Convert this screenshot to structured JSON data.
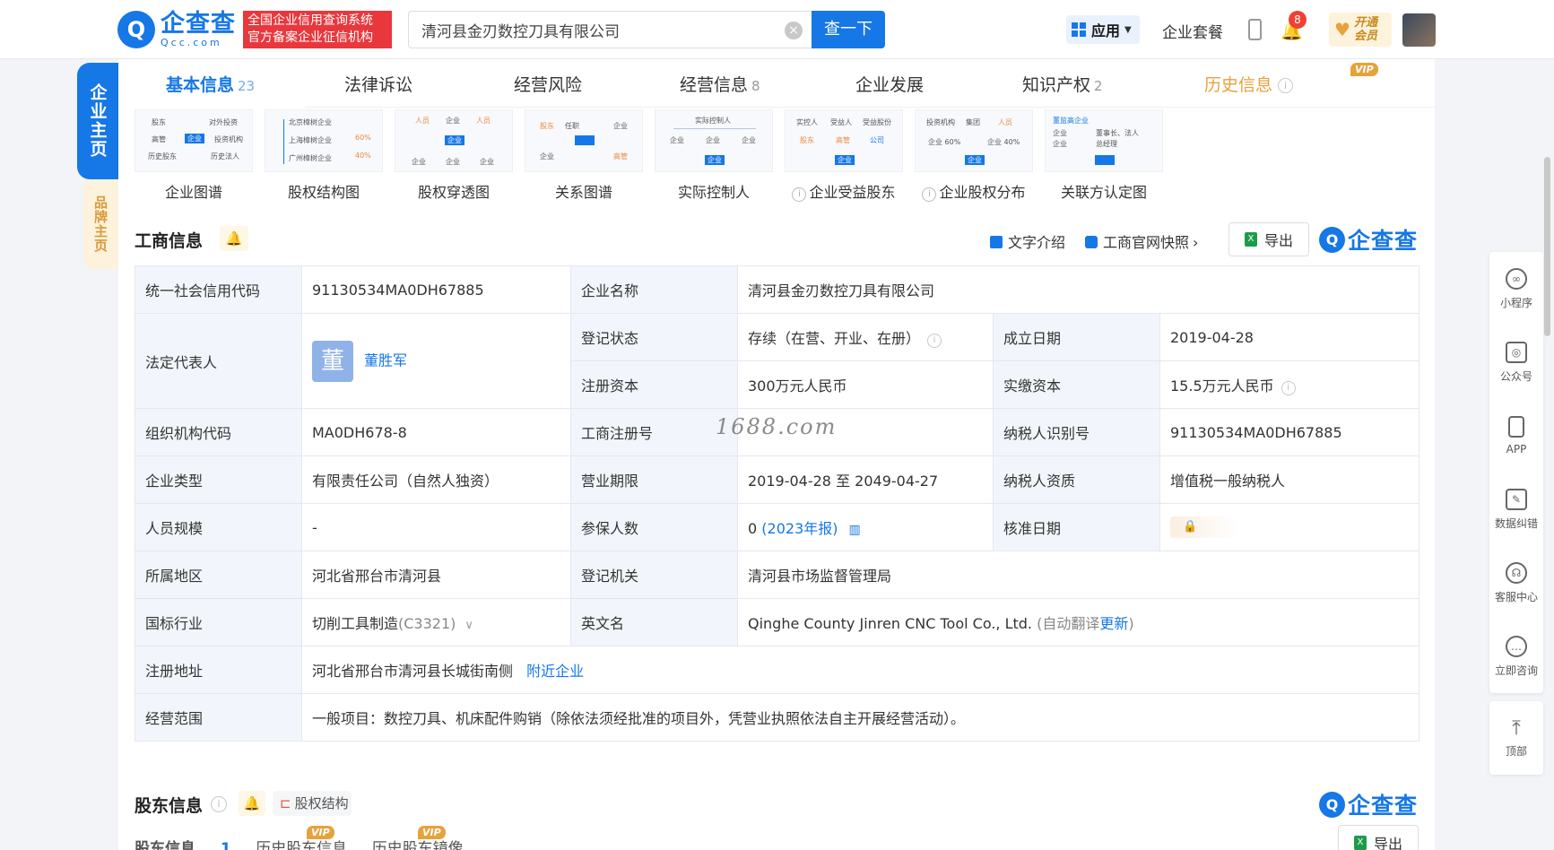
{
  "header": {
    "logo_cn": "企查查",
    "logo_en": "Qcc.com",
    "slogan_line1": "全国企业信用查询系统",
    "slogan_line2": "官方备案企业征信机构",
    "search_value": "清河县金刃数控刀具有限公司",
    "search_button": "查一下",
    "app_label": "应用",
    "package_label": "企业套餐",
    "notification_count": "8",
    "vip_line1": "开通",
    "vip_line2": "会员"
  },
  "side": {
    "main_tab": "企业主页",
    "brand_tab": "品牌主页"
  },
  "tabs": [
    {
      "label": "基本信息",
      "count": "23"
    },
    {
      "label": "法律诉讼",
      "count": ""
    },
    {
      "label": "经营风险",
      "count": ""
    },
    {
      "label": "经营信息",
      "count": "8"
    },
    {
      "label": "企业发展",
      "count": ""
    },
    {
      "label": "知识产权",
      "count": "2"
    },
    {
      "label": "历史信息",
      "count": ""
    }
  ],
  "vip_label": "VIP",
  "graphs": [
    {
      "label": "企业图谱"
    },
    {
      "label": "股权结构图"
    },
    {
      "label": "股权穿透图"
    },
    {
      "label": "关系图谱"
    },
    {
      "label": "实际控制人"
    },
    {
      "label": "企业受益股东"
    },
    {
      "label": "企业股权分布"
    },
    {
      "label": "关联方认定图"
    }
  ],
  "graph_thumbs": {
    "g1": [
      "股东",
      "对外投资",
      "高管",
      "投资机构",
      "历史股东",
      "历史法人",
      "企业"
    ],
    "g2": [
      "北京樟树企业",
      "上海樟树企业",
      "广州樟树企业",
      "60%",
      "40%"
    ],
    "g3": [
      "人员",
      "企业",
      "人员",
      "企业",
      "企业",
      "企业",
      "企业"
    ],
    "g4": [
      "股东",
      "任职",
      "企业",
      "企业",
      "高管"
    ],
    "g5": [
      "实际控制人",
      "企业",
      "企业",
      "企业",
      "企业"
    ],
    "g6": [
      "实控人",
      "受益人",
      "受益股份",
      "股东",
      "高管",
      "公司",
      "企业"
    ],
    "g7": [
      "投资机构",
      "集团",
      "人员",
      "企业 60%",
      "企业 40%",
      "企业"
    ],
    "g8": [
      "董监高企业",
      "董事长、法人",
      "总经理",
      "企业",
      "企业"
    ]
  },
  "section": {
    "title": "工商信息",
    "text_intro": "文字介绍",
    "snapshot": "工商官网快照",
    "export": "导出",
    "brand": "企查查"
  },
  "info": {
    "credit_code_k": "统一社会信用代码",
    "credit_code_v": "91130534MA0DH67885",
    "name_k": "企业名称",
    "name_v": "清河县金刃数控刀具有限公司",
    "legal_k": "法定代表人",
    "legal_avatar": "董",
    "legal_v": "董胜军",
    "status_k": "登记状态",
    "status_v": "存续（在营、开业、在册）",
    "found_k": "成立日期",
    "found_v": "2019-04-28",
    "reg_cap_k": "注册资本",
    "reg_cap_v": "300万元人民币",
    "paid_cap_k": "实缴资本",
    "paid_cap_v": "15.5万元人民币",
    "org_code_k": "组织机构代码",
    "org_code_v": "MA0DH678-8",
    "reg_no_k": "工商注册号",
    "reg_no_v": "",
    "tax_id_k": "纳税人识别号",
    "tax_id_v": "91130534MA0DH67885",
    "type_k": "企业类型",
    "type_v": "有限责任公司（自然人独资）",
    "term_k": "营业期限",
    "term_v": "2019-04-28 至 2049-04-27",
    "tax_qual_k": "纳税人资质",
    "tax_qual_v": "增值税一般纳税人",
    "staff_k": "人员规模",
    "staff_v": "-",
    "insured_k": "参保人数",
    "insured_v": "0",
    "insured_year": "(2023年报)",
    "approve_k": "核准日期",
    "region_k": "所属地区",
    "region_v": "河北省邢台市清河县",
    "authority_k": "登记机关",
    "authority_v": "清河县市场监督管理局",
    "industry_k": "国标行业",
    "industry_v": "切削工具制造",
    "industry_code": "(C3321)",
    "en_name_k": "英文名",
    "en_name_v": "Qinghe County Jinren CNC Tool Co., Ltd.",
    "en_name_note_pre": "(自动翻译",
    "en_name_update": "更新",
    "en_name_note_post": ")",
    "address_k": "注册地址",
    "address_v": "河北省邢台市清河县长城街南侧",
    "address_link": "附近企业",
    "scope_k": "经营范围",
    "scope_v": "一般项目：数控刀具、机床配件购销（除依法须经批准的项目外，凭营业执照依法自主开展经营活动）。"
  },
  "watermark": "1688.com",
  "shareholders": {
    "title": "股东信息",
    "struct_btn": "股权结构",
    "brand": "企查查",
    "export": "导出",
    "tab_current": "股东信息",
    "tab_current_count": "1",
    "tab_history": "历史股东信息",
    "tab_mirror": "历史股东镜像"
  },
  "right_toolbar": [
    {
      "label": "小程序"
    },
    {
      "label": "公众号"
    },
    {
      "label": "APP"
    },
    {
      "label": "数据纠错"
    },
    {
      "label": "客服中心"
    },
    {
      "label": "立即咨询"
    },
    {
      "label": "顶部"
    }
  ],
  "colors": {
    "accent": "#1677e6",
    "vip": "#e6a23c",
    "slogan_bg": "#e8383d"
  }
}
